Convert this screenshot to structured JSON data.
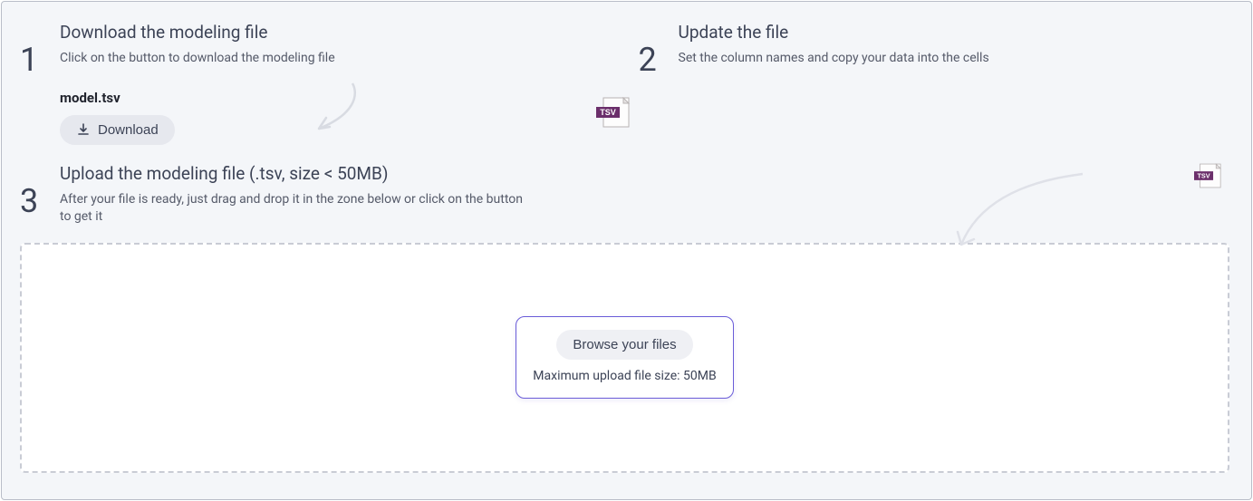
{
  "steps": {
    "one": {
      "num": "1",
      "title": "Download the modeling file",
      "desc": "Click on the button to download the modeling file",
      "filename": "model.tsv",
      "download_label": "Download"
    },
    "two": {
      "num": "2",
      "title": "Update the file",
      "desc": "Set the column names and copy your data into the cells"
    },
    "three": {
      "num": "3",
      "title": "Upload the modeling file (.tsv, size < 50MB)",
      "desc": "After your file is ready, just drag and drop it in the zone below or click on the button to get it"
    }
  },
  "dropzone": {
    "browse_label": "Browse your files",
    "size_hint": "Maximum upload file size: 50MB"
  },
  "icons": {
    "tsv_badge": "TSV"
  }
}
